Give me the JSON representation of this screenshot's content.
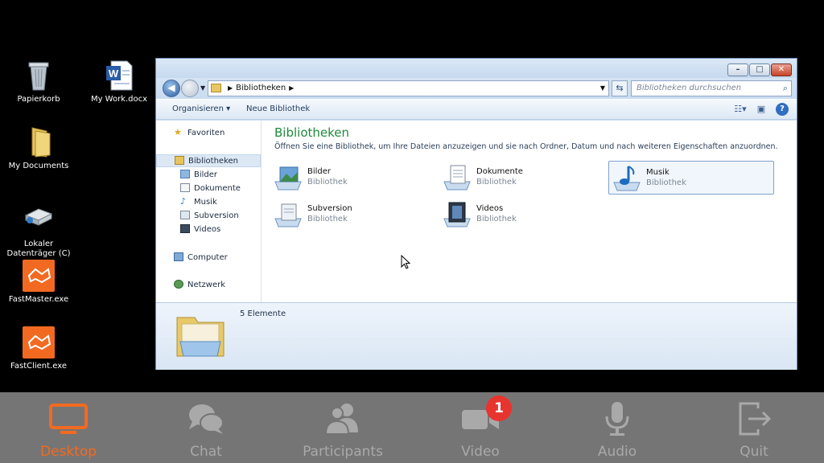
{
  "desktop": {
    "icons": [
      {
        "label": "Papierkorb",
        "icon": "recycle-bin-icon"
      },
      {
        "label": "My Work.docx",
        "icon": "word-document-icon"
      },
      {
        "label": "My Documents",
        "icon": "folder-icon"
      },
      {
        "label": "Lokaler Datenträger (C)",
        "icon": "drive-icon"
      },
      {
        "label": "FastMaster.exe",
        "icon": "fastmaster-app-icon"
      },
      {
        "label": "FastClient.exe",
        "icon": "fastclient-app-icon"
      }
    ]
  },
  "explorer": {
    "address": {
      "crumb": "Bibliotheken"
    },
    "search": {
      "placeholder": "Bibliotheken durchsuchen"
    },
    "toolbar": {
      "organize": "Organisieren ▾",
      "new_library": "Neue Bibliothek"
    },
    "nav": {
      "favorites": "Favoriten",
      "libraries": "Bibliotheken",
      "library_items": [
        "Bilder",
        "Dokumente",
        "Musik",
        "Subversion",
        "Videos"
      ],
      "computer": "Computer",
      "network": "Netzwerk"
    },
    "content": {
      "title": "Bibliotheken",
      "description": "Öffnen Sie eine Bibliothek, um Ihre Dateien anzuzeigen und sie nach Ordner, Datum und nach weiteren Eigenschaften anzuordnen.",
      "libraries": [
        {
          "name": "Bilder",
          "type": "Bibliothek"
        },
        {
          "name": "Dokumente",
          "type": "Bibliothek"
        },
        {
          "name": "Musik",
          "type": "Bibliothek"
        },
        {
          "name": "Subversion",
          "type": "Bibliothek"
        },
        {
          "name": "Videos",
          "type": "Bibliothek"
        }
      ]
    },
    "details": {
      "count": "5 Elemente"
    }
  },
  "bottombar": {
    "items": [
      {
        "label": "Desktop",
        "icon": "monitor-icon"
      },
      {
        "label": "Chat",
        "icon": "chat-icon"
      },
      {
        "label": "Participants",
        "icon": "participants-icon"
      },
      {
        "label": "Video",
        "icon": "video-camera-icon"
      },
      {
        "label": "Audio",
        "icon": "microphone-icon"
      },
      {
        "label": "Quit",
        "icon": "exit-icon"
      }
    ],
    "video_badge": "1",
    "active_color": "#f26a21",
    "inactive_color": "#a9a9a9"
  }
}
